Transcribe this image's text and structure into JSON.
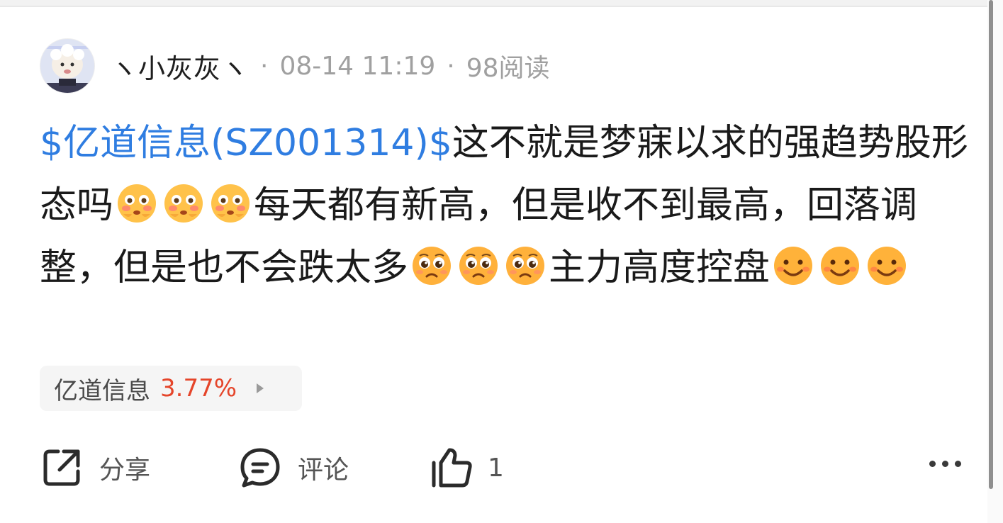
{
  "post": {
    "author": "ヽ小灰灰ヽ",
    "time": "08-14 11:19",
    "reads": "98阅读",
    "separator": "·",
    "content": {
      "stock_link": "$亿道信息(SZ001314)$",
      "part1": "这不就是梦寐以求的强趋势股形态吗",
      "emoji1": "flushed-face",
      "part2": "每天都有新高，但是收不到最高，回落调整，但是也不会跌太多",
      "emoji2": "pleading-face",
      "part3": "主力高度控盘",
      "emoji3": "smiling-face"
    }
  },
  "stock_chip": {
    "name": "亿道信息",
    "change": "3.77%",
    "change_color": "#e5452a"
  },
  "actions": {
    "share_label": "分享",
    "comment_label": "评论",
    "like_count": "1"
  },
  "colors": {
    "link": "#2f7de1",
    "text": "#1a1a1a",
    "muted": "#a0a0a0"
  }
}
